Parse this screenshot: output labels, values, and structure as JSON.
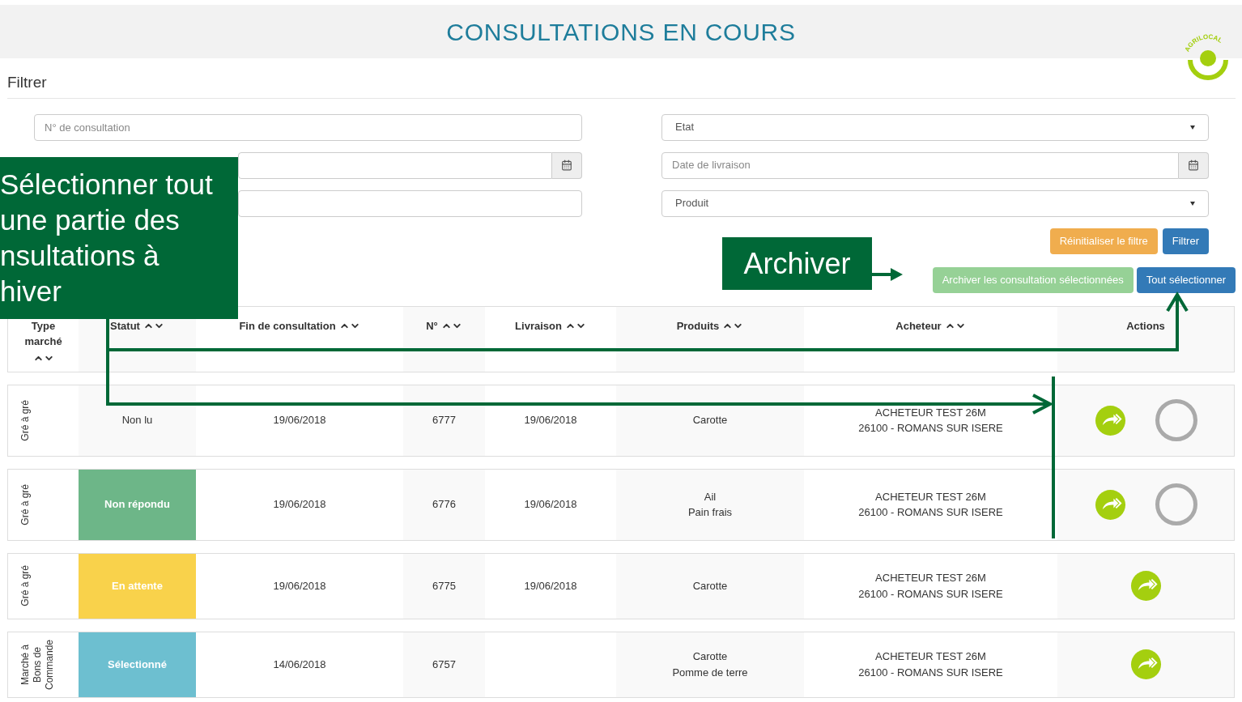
{
  "header": {
    "title": "CONSULTATIONS EN COURS",
    "logo_text": "AGRILOCAL"
  },
  "filter": {
    "title": "Filtrer",
    "left_fields": [
      {
        "kind": "input",
        "placeholder": "N° de consultation"
      },
      {
        "kind": "date"
      },
      {
        "kind": "input"
      }
    ],
    "right_fields": [
      {
        "kind": "select",
        "value": "Etat"
      },
      {
        "kind": "date",
        "placeholder": "Date de livraison"
      },
      {
        "kind": "select",
        "value": "Produit"
      }
    ],
    "buttons": [
      {
        "label": "Réinitialiser le filtre",
        "kind": "warning"
      },
      {
        "label": "Filtrer",
        "kind": "primary"
      }
    ],
    "actions": [
      {
        "label": "Archiver les consultation sélectionnées",
        "kind": "disabled"
      },
      {
        "label": "Tout sélectionner",
        "kind": "primary"
      }
    ]
  },
  "table": {
    "columns": [
      {
        "label": "Type marché",
        "sortable": true
      },
      {
        "label": "Statut",
        "sortable": true
      },
      {
        "label": "Fin de consultation",
        "sortable": true
      },
      {
        "label": "N°",
        "sortable": true
      },
      {
        "label": "Livraison",
        "sortable": true
      },
      {
        "label": "Produits",
        "sortable": true
      },
      {
        "label": "Acheteur",
        "sortable": true
      },
      {
        "label": "Actions",
        "sortable": false
      }
    ],
    "rows": [
      {
        "type": "Gré à gré",
        "status": {
          "label": "Non lu"
        },
        "end": "19/06/2018",
        "number": "6777",
        "delivery": "19/06/2018",
        "products": [
          "Carotte"
        ],
        "buyer": [
          "ACHETEUR TEST 26M",
          "26100 - ROMANS SUR ISERE"
        ],
        "actions": [
          {
            "kind": "forward"
          },
          {
            "kind": "select",
            "checked": false
          }
        ]
      },
      {
        "type": "Gré à gré",
        "status": {
          "label": "Non répondu",
          "color": "#6db688"
        },
        "end": "19/06/2018",
        "number": "6776",
        "delivery": "19/06/2018",
        "products": [
          "Ail",
          "Pain frais"
        ],
        "buyer": [
          "ACHETEUR TEST 26M",
          "26100 - ROMANS SUR ISERE"
        ],
        "actions": [
          {
            "kind": "forward"
          },
          {
            "kind": "select",
            "checked": false
          }
        ]
      },
      {
        "type": "Gré à gré",
        "status": {
          "label": "En attente",
          "color": "#f9d24b"
        },
        "end": "19/06/2018",
        "number": "6775",
        "delivery": "19/06/2018",
        "products": [
          "Carotte"
        ],
        "buyer": [
          "ACHETEUR TEST 26M",
          "26100 - ROMANS SUR ISERE"
        ],
        "actions": [
          {
            "kind": "forward"
          }
        ]
      },
      {
        "type": "Marché à Bons de Commande",
        "status": {
          "label": "Sélectionné",
          "color": "#6dbfd0"
        },
        "end": "14/06/2018",
        "number": "6757",
        "products": [
          "Carotte",
          "Pomme de terre"
        ],
        "buyer": [
          "ACHETEUR TEST 26M",
          "26100 - ROMANS SUR ISERE"
        ],
        "actions": [
          {
            "kind": "forward"
          }
        ]
      }
    ]
  },
  "annotations": [
    {
      "kind": "select-all",
      "lines": [
        "Sélectionner tout",
        "une partie des",
        "nsultations à",
        "hiver"
      ]
    },
    {
      "kind": "archive",
      "lines": [
        "Archiver"
      ]
    }
  ]
}
